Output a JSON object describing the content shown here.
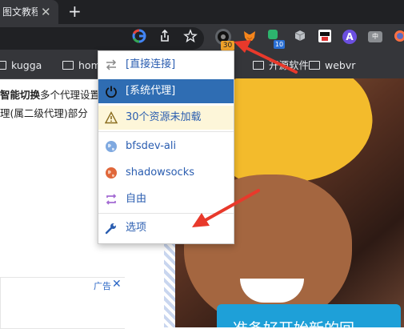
{
  "tab": {
    "title": "图文教程",
    "close": "✕"
  },
  "new_tab_label": "+",
  "toolbar": {
    "switchyomega_badge": "30",
    "ext_badge": "10",
    "ext_a_label": "A",
    "ext_cn_label": "中"
  },
  "bookmarks": [
    "kugga",
    "hom",
    "开源软件",
    "webvr"
  ],
  "content": {
    "line1_bold": "智能切换",
    "line1_rest": "多个代理设置",
    "line2": "理(属二级代理)部分",
    "ad_label": "广告",
    "ad_close": "✕",
    "banner_text": "准备好开始新的回"
  },
  "menu": {
    "items": [
      {
        "label": "[直接连接]",
        "icon": "direct-icon"
      },
      {
        "label": "[系统代理]",
        "icon": "power-icon"
      },
      {
        "label": "30个资源未加载",
        "icon": "warning-icon"
      },
      {
        "label": "bfsdev-ali",
        "icon": "globe-icon"
      },
      {
        "label": "shadowsocks",
        "icon": "globe-orange-icon"
      },
      {
        "label": "自由",
        "icon": "autoswitch-icon"
      },
      {
        "label": "选项",
        "icon": "wrench-icon"
      }
    ]
  },
  "colors": {
    "menu_active": "#2f6db3",
    "menu_text": "#2a5db0",
    "warning_bg": "#fdf6d9",
    "arrow": "#e8392b"
  }
}
